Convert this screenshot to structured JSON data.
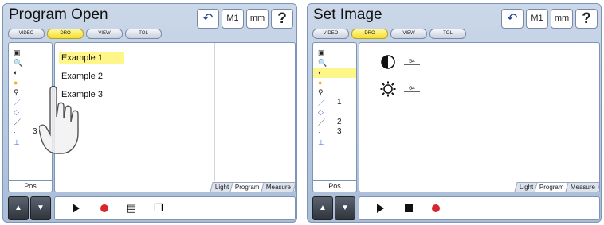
{
  "left_panel": {
    "title": "Program Open",
    "tabs": [
      "VIDEO",
      "DRO",
      "VIEW",
      "TOL"
    ],
    "active_tab": "DRO",
    "top_buttons": {
      "undo": "↶",
      "m1": "M1",
      "mm": "mm",
      "help": "?"
    },
    "tools": [
      {
        "icon": "▣",
        "num": ""
      },
      {
        "icon": "🔍",
        "num": ""
      },
      {
        "icon": "◐",
        "num": ""
      },
      {
        "icon": "●",
        "num": ""
      },
      {
        "icon": "⚲",
        "num": ""
      },
      {
        "icon": "／",
        "num": ""
      },
      {
        "icon": "◇",
        "num": ""
      },
      {
        "icon": "／",
        "num": ""
      },
      {
        "icon": "·",
        "num": "3"
      },
      {
        "icon": "⊥",
        "num": ""
      }
    ],
    "pos_label": "Pos",
    "programs": [
      "Example 1",
      "Example 2",
      "Example 3"
    ],
    "bottom_tabs": [
      "Light",
      "Program",
      "Measure"
    ],
    "active_bottom_tab": "Program"
  },
  "right_panel": {
    "title": "Set Image",
    "tabs": [
      "VIDEO",
      "DRO",
      "VIEW",
      "TOL"
    ],
    "active_tab": "DRO",
    "top_buttons": {
      "undo": "↶",
      "m1": "M1",
      "mm": "mm",
      "help": "?"
    },
    "tools": [
      {
        "icon": "▣",
        "num": ""
      },
      {
        "icon": "🔍",
        "num": ""
      },
      {
        "icon": "◐",
        "num": ""
      },
      {
        "icon": "●",
        "num": ""
      },
      {
        "icon": "⚲",
        "num": ""
      },
      {
        "icon": "／",
        "num": "1"
      },
      {
        "icon": "◇",
        "num": ""
      },
      {
        "icon": "／",
        "num": "2"
      },
      {
        "icon": "·",
        "num": "3"
      },
      {
        "icon": "⊥",
        "num": ""
      }
    ],
    "pos_label": "Pos",
    "contrast_value": "54",
    "brightness_value": "64",
    "bottom_tabs": [
      "Light",
      "Program",
      "Measure"
    ],
    "active_bottom_tab": "Program"
  },
  "colors": {
    "highlight": "#fff68a",
    "record": "#d8262e",
    "panel": "#b9cae2"
  }
}
